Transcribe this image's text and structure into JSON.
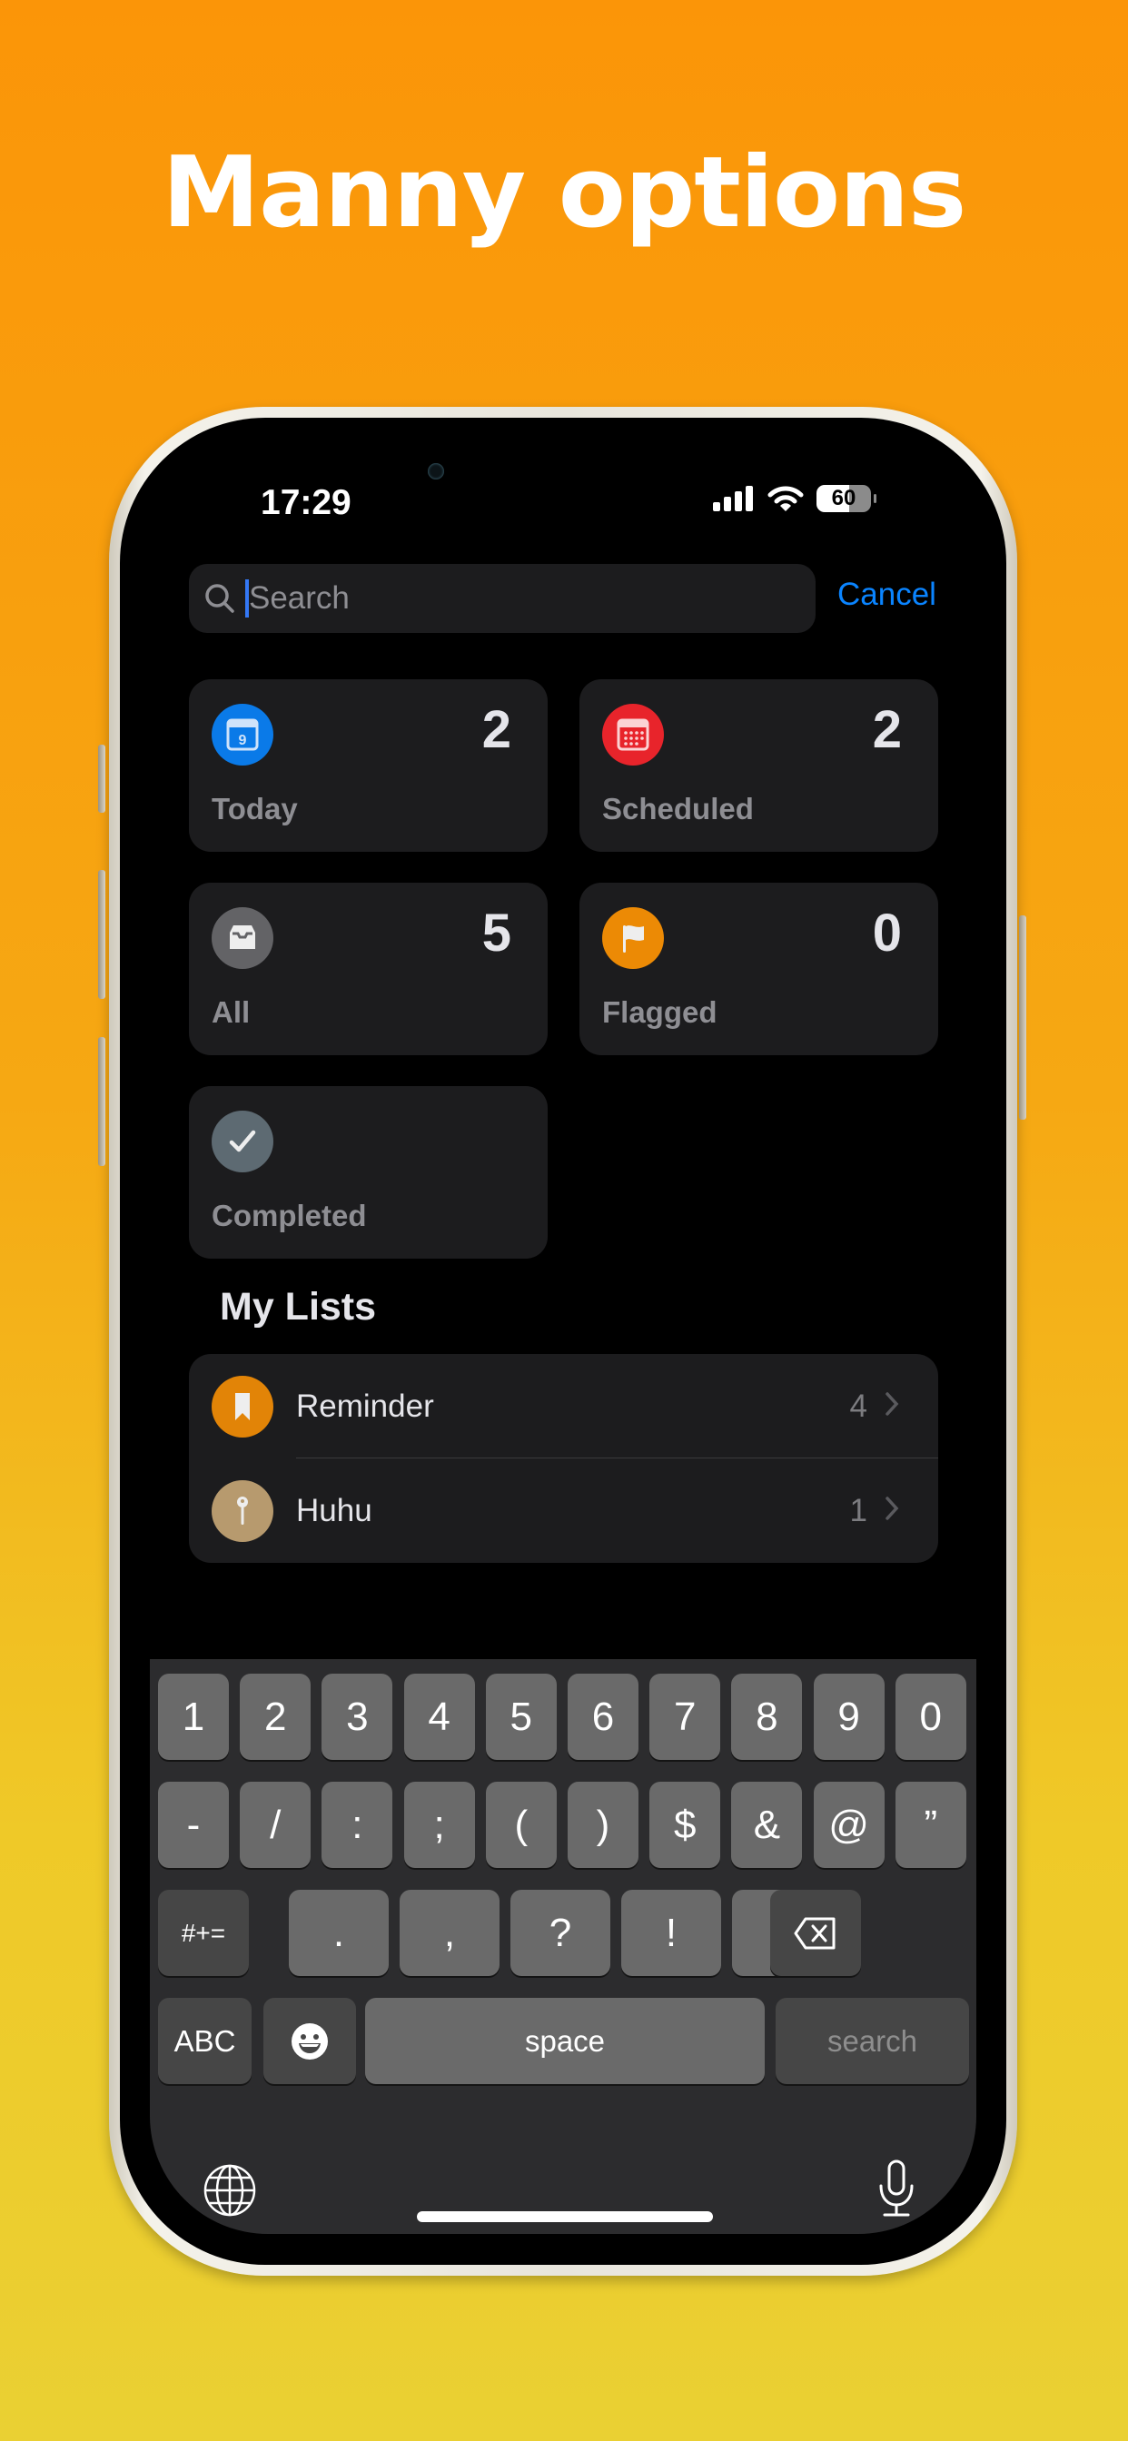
{
  "headline": "Manny options",
  "status_bar": {
    "time": "17:29",
    "battery_percent": "60"
  },
  "search": {
    "placeholder": "Search",
    "cancel_label": "Cancel"
  },
  "smart_lists": [
    {
      "label": "Today",
      "count": "2",
      "icon": "calendar-day-icon",
      "color": "#0a7ae8",
      "day": "9"
    },
    {
      "label": "Scheduled",
      "count": "2",
      "icon": "calendar-grid-icon",
      "color": "#e8242b"
    },
    {
      "label": "All",
      "count": "5",
      "icon": "tray-icon",
      "color": "#636366"
    },
    {
      "label": "Flagged",
      "count": "0",
      "icon": "flag-icon",
      "color": "#ec8a05"
    },
    {
      "label": "Completed",
      "count": "",
      "icon": "checkmark-icon",
      "color": "#5d6a72"
    }
  ],
  "my_lists": {
    "title": "My Lists",
    "items": [
      {
        "name": "Reminder",
        "count": "4",
        "icon": "bookmark-icon",
        "color": "#e28407"
      },
      {
        "name": "Huhu",
        "count": "1",
        "icon": "pin-icon",
        "color": "#b79a6e"
      }
    ]
  },
  "keyboard": {
    "row1": [
      "1",
      "2",
      "3",
      "4",
      "5",
      "6",
      "7",
      "8",
      "9",
      "0"
    ],
    "row2": [
      "-",
      "/",
      ":",
      ";",
      "(",
      ")",
      "$",
      "&",
      "@",
      "”"
    ],
    "row3": [
      ".",
      ",",
      "?",
      "!",
      "’"
    ],
    "symbols_label": "#+=",
    "abc_label": "ABC",
    "space_label": "space",
    "search_label": "search"
  }
}
